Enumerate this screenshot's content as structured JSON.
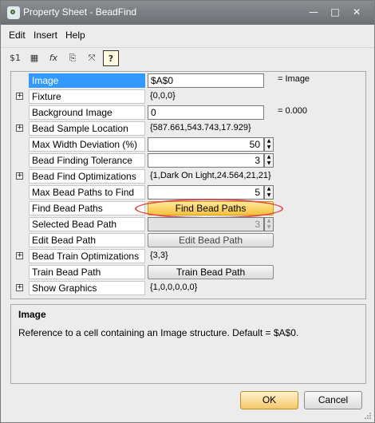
{
  "window": {
    "title": "Property Sheet - BeadFind",
    "minimize": "—",
    "maximize": "□",
    "close": "✕"
  },
  "menu": {
    "items": [
      "Edit",
      "Insert",
      "Help"
    ]
  },
  "toolbar": {
    "buttons": [
      {
        "icon": "numeric-list-icon",
        "glyph": "$1"
      },
      {
        "icon": "grid-table-icon",
        "glyph": "▦"
      },
      {
        "icon": "function-icon",
        "glyph": "fx"
      },
      {
        "icon": "document-icon",
        "glyph": "⎘"
      },
      {
        "icon": "resize-icon",
        "glyph": "⤧"
      },
      {
        "icon": "help-icon",
        "glyph": "?"
      }
    ]
  },
  "properties": [
    {
      "name": "Image",
      "value": "$A$0",
      "extra": "= Image",
      "type": "input",
      "selected": true,
      "expandable": false
    },
    {
      "name": "Fixture",
      "value": "{0,0,0}",
      "type": "text",
      "expandable": true
    },
    {
      "name": "Background Image",
      "value": "0",
      "extra": "= 0.000",
      "type": "input",
      "expandable": false
    },
    {
      "name": "Bead Sample Location",
      "value": "{587.661,543.743,17.929}",
      "type": "text",
      "expandable": true
    },
    {
      "name": "Max Width Deviation (%)",
      "value": "50",
      "type": "spinner",
      "expandable": false
    },
    {
      "name": "Bead Finding Tolerance",
      "value": "3",
      "type": "spinner",
      "expandable": false
    },
    {
      "name": "Bead Find Optimizations",
      "value": "{1,Dark On Light,24.564,21,21}",
      "type": "text",
      "expandable": true
    },
    {
      "name": "Max Bead Paths to Find",
      "value": "5",
      "type": "spinner",
      "expandable": false
    },
    {
      "name": "Find Bead Paths",
      "value": "Find Bead Paths",
      "type": "button-highlight",
      "expandable": false
    },
    {
      "name": "Selected Bead Path",
      "value": "3",
      "type": "spinner-disabled",
      "expandable": false
    },
    {
      "name": "Edit Bead Path",
      "value": "Edit Bead Path",
      "type": "button-disabled",
      "expandable": false
    },
    {
      "name": "Bead Train Optimizations",
      "value": "{3,3}",
      "type": "text",
      "expandable": true
    },
    {
      "name": "Train Bead Path",
      "value": "Train Bead Path",
      "type": "button",
      "expandable": false
    },
    {
      "name": "Show Graphics",
      "value": "{1,0,0,0,0,0}",
      "type": "text",
      "expandable": true
    }
  ],
  "description": {
    "title": "Image",
    "text": "Reference to a cell containing an Image structure. Default = $A$0."
  },
  "footer": {
    "ok": "OK",
    "cancel": "Cancel"
  },
  "colors": {
    "selected": "#3399ff",
    "highlight": "#f6c23e",
    "circle": "#e04b4b",
    "titlebar": "#7c7f83"
  }
}
